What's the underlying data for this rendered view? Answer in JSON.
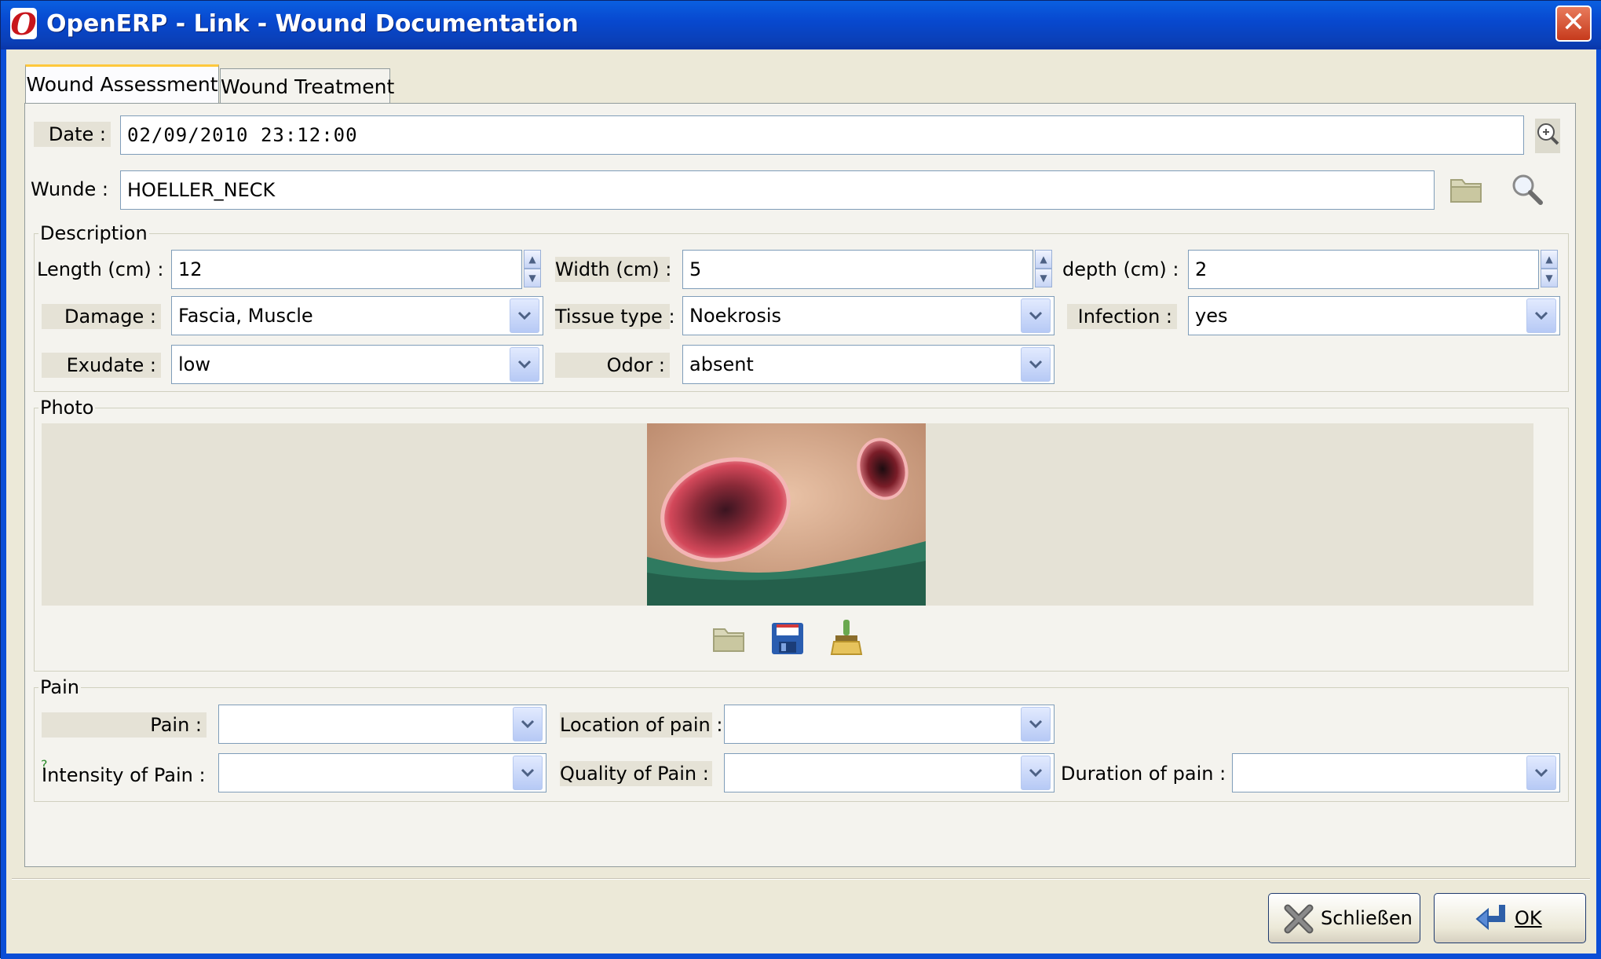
{
  "window": {
    "title": "OpenERP - Link - Wound Documentation",
    "logo_letter": "O",
    "close_glyph": "✕"
  },
  "tabs": [
    {
      "label": "Wound Assessment",
      "active": true
    },
    {
      "label": "Wound Treatment",
      "active": false
    }
  ],
  "fields": {
    "date": {
      "label": "Date :",
      "value": "02/09/2010 23:12:00"
    },
    "wunde": {
      "label": "Wunde :",
      "value": "HOELLER_NECK"
    }
  },
  "description": {
    "legend": "Description",
    "length": {
      "label": "Length (cm) :",
      "value": "12"
    },
    "width": {
      "label": "Width (cm) :",
      "value": "5"
    },
    "depth": {
      "label": "depth (cm) :",
      "value": "2"
    },
    "damage": {
      "label": "Damage :",
      "value": "Fascia, Muscle"
    },
    "tissue_type": {
      "label": "Tissue type :",
      "value": "Noekrosis"
    },
    "infection": {
      "label": "Infection :",
      "value": "yes"
    },
    "exudate": {
      "label": "Exudate :",
      "value": "low"
    },
    "odor": {
      "label": "Odor :",
      "value": "absent"
    }
  },
  "photo": {
    "legend": "Photo"
  },
  "pain": {
    "legend": "Pain",
    "pain": {
      "label": "Pain :",
      "value": ""
    },
    "location": {
      "label": "Location of pain :",
      "value": ""
    },
    "intensity": {
      "label": "Intensity of Pain :",
      "value": "",
      "help_mark": "?"
    },
    "quality": {
      "label": "Quality of Pain :",
      "value": ""
    },
    "duration": {
      "label": "Duration of pain :",
      "value": ""
    }
  },
  "footer": {
    "close_label": "Schließen",
    "ok_label": "OK"
  },
  "icons": {
    "zoom": "zoom-in-icon",
    "folder": "folder-icon",
    "search": "search-icon",
    "save": "floppy-disk-icon",
    "clear": "broom-icon"
  },
  "colors": {
    "titlebar": "#0a49d0",
    "window_bg": "#ece9d8",
    "input_border": "#7f9db9",
    "tab_highlight": "#ffc83c"
  }
}
